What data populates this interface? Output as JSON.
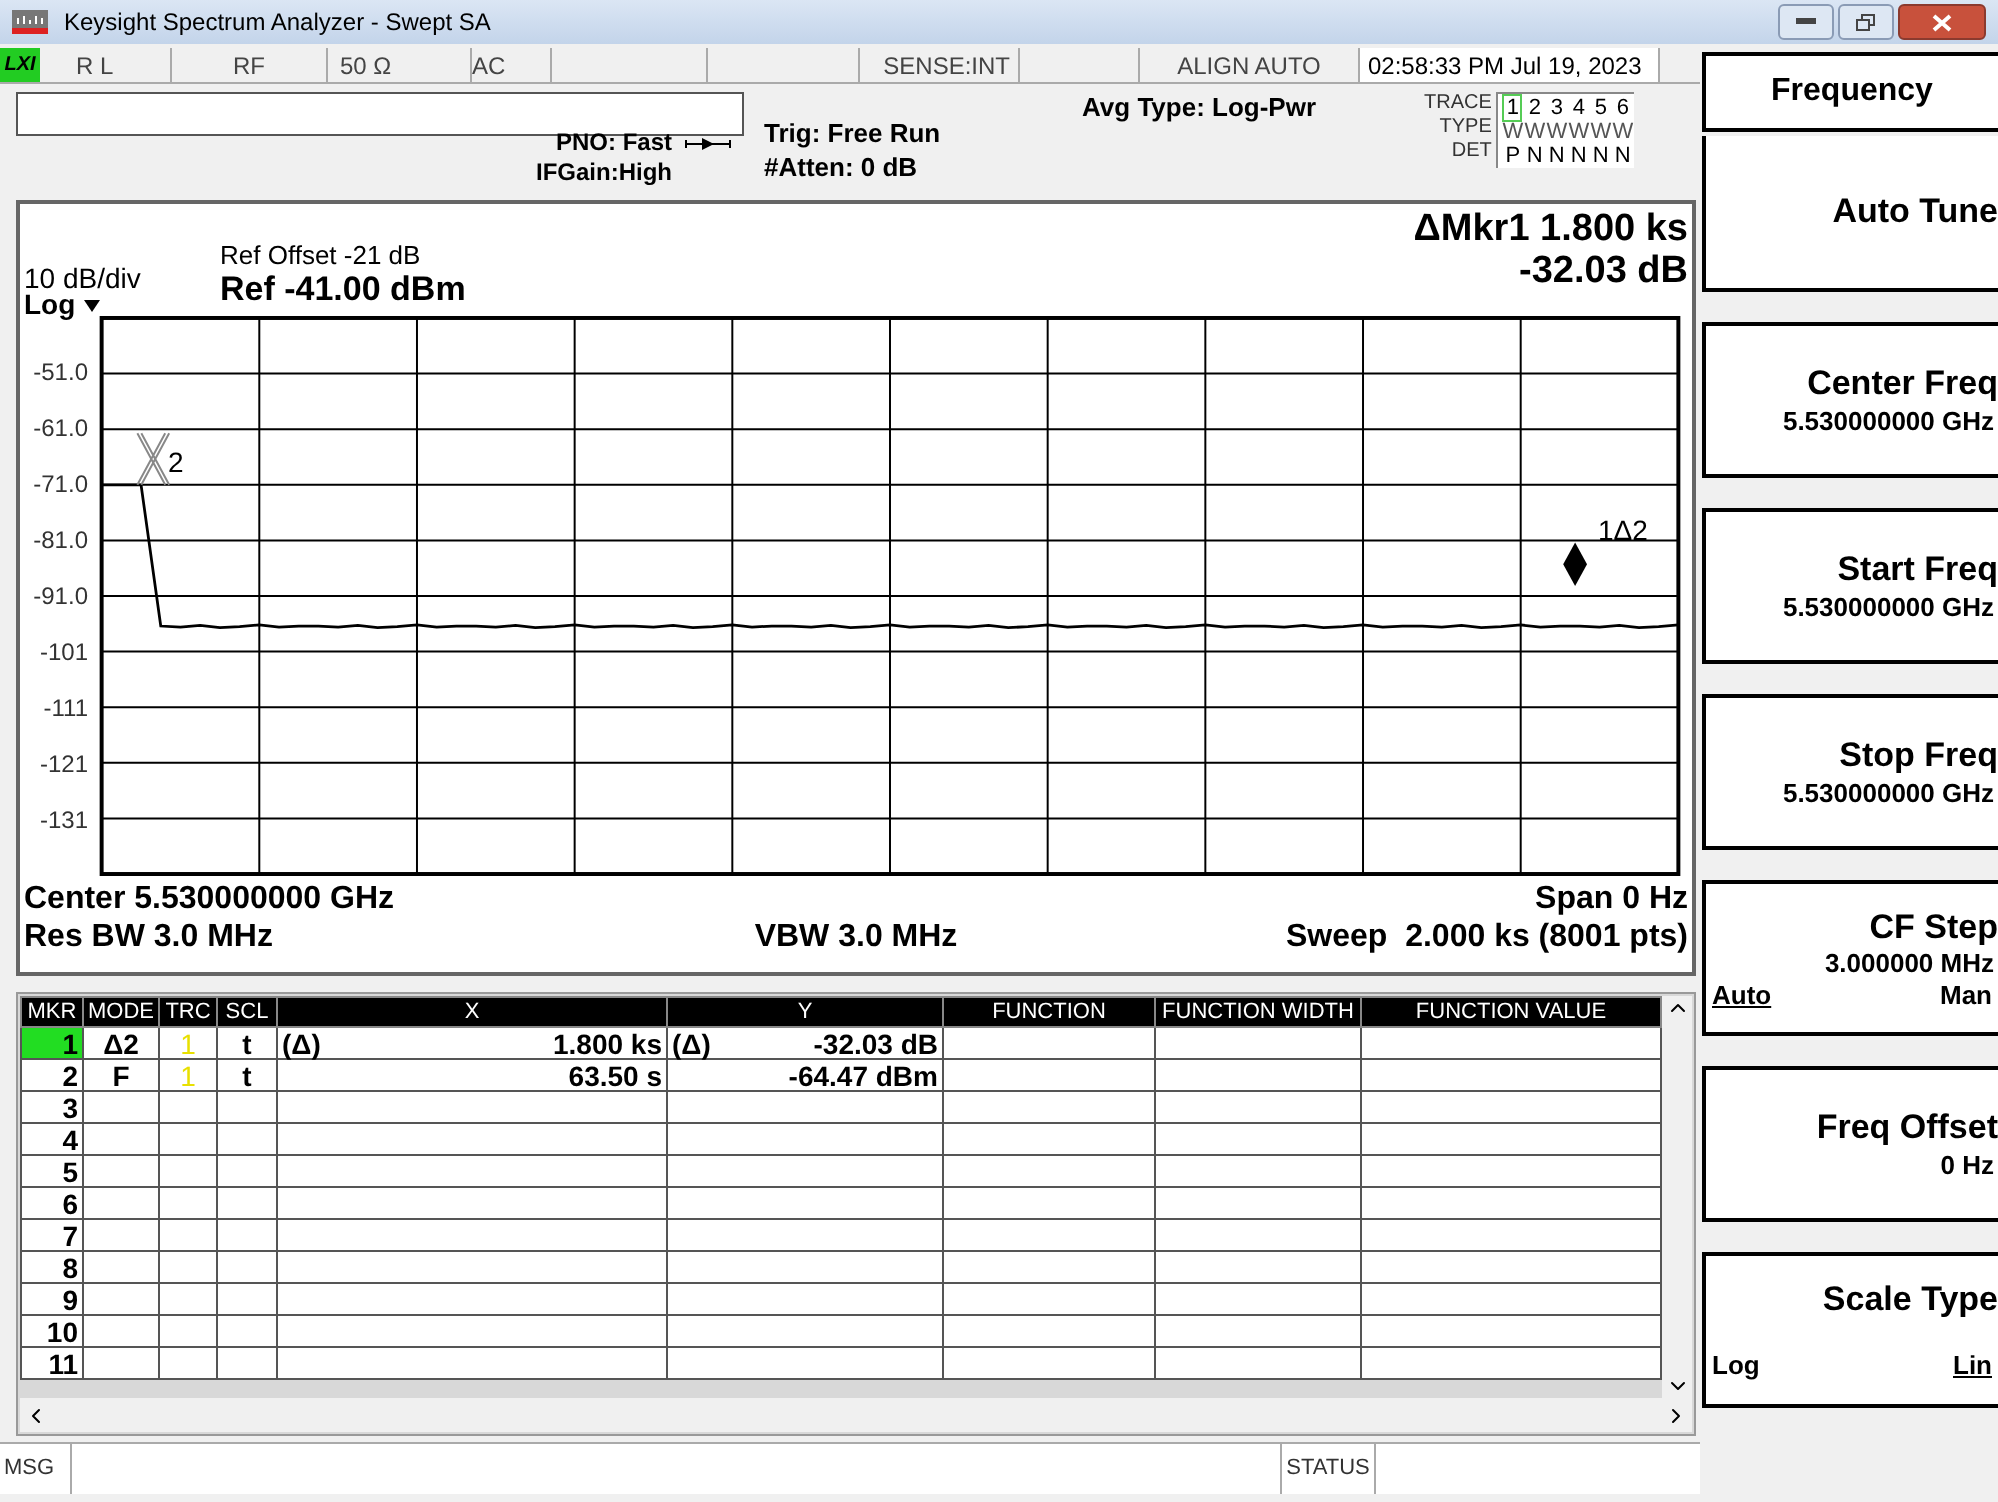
{
  "window": {
    "title": "Keysight Spectrum Analyzer - Swept SA"
  },
  "status_row": {
    "logo": "LXI",
    "cells": [
      "R L",
      "RF",
      "50 Ω",
      "AC",
      "",
      "",
      "SENSE:INT",
      "",
      "ALIGN AUTO",
      "02:58:33 PM Jul 19, 2023"
    ]
  },
  "header": {
    "pno": "PNO: Fast",
    "ifgain": "IFGain:High",
    "trig": "Trig: Free Run",
    "atten": "#Atten: 0 dB",
    "avg_type": "Avg Type: Log-Pwr",
    "trace_labels": [
      "TRACE",
      "TYPE",
      "DET"
    ],
    "traces": [
      {
        "number": "1",
        "type": "W",
        "det": "P",
        "selected": true
      },
      {
        "number": "2",
        "type": "W",
        "det": "N",
        "selected": false
      },
      {
        "number": "3",
        "type": "W",
        "det": "N",
        "selected": false
      },
      {
        "number": "4",
        "type": "W",
        "det": "N",
        "selected": false
      },
      {
        "number": "5",
        "type": "W",
        "det": "N",
        "selected": false
      },
      {
        "number": "6",
        "type": "W",
        "det": "N",
        "selected": false
      }
    ]
  },
  "plot": {
    "scale": "10 dB/div",
    "scale_type": "Log",
    "ref_offset": "Ref Offset -21 dB",
    "ref_level": "Ref -41.00 dBm",
    "marker_readout": "ΔMkr1 1.800 ks",
    "marker_value": "-32.03 dB",
    "chart_data": {
      "type": "line",
      "grid": true,
      "ylim": [
        -141,
        -41
      ],
      "yticks": [
        {
          "value": -51,
          "label": "-51.0"
        },
        {
          "value": -61,
          "label": "-61.0"
        },
        {
          "value": -71,
          "label": "-71.0"
        },
        {
          "value": -81,
          "label": "-81.0"
        },
        {
          "value": -91,
          "label": "-91.0"
        },
        {
          "value": -101,
          "label": "-101"
        },
        {
          "value": -111,
          "label": "-111"
        },
        {
          "value": -121,
          "label": "-121"
        },
        {
          "value": -131,
          "label": "-131"
        }
      ],
      "categories": [
        null,
        null,
        null,
        null,
        null,
        null,
        null,
        null,
        null,
        null,
        null,
        null,
        null,
        null,
        null,
        null,
        null,
        null,
        null,
        null,
        null,
        null,
        null,
        null,
        null,
        null,
        null,
        null,
        null,
        null,
        null,
        null,
        null,
        null,
        null,
        null,
        null,
        null,
        null,
        null,
        null,
        null,
        null,
        null,
        null,
        null,
        null,
        null,
        null,
        null,
        null,
        null,
        null,
        null,
        null,
        null,
        null,
        null,
        null,
        null,
        null,
        null,
        null,
        null,
        null,
        null,
        null,
        null,
        null,
        null,
        null,
        null,
        null,
        null,
        null,
        null,
        null,
        null,
        null,
        null,
        null
      ],
      "series": [
        {
          "color": "#000000",
          "values": [
            -71,
            -71,
            -71,
            -96.4,
            -96.6,
            -96.3,
            -96.7,
            -96.5,
            -96.2,
            -96.6,
            -96.4,
            -96.4,
            -96.6,
            -96.3,
            -96.7,
            -96.5,
            -96.2,
            -96.6,
            -96.4,
            -96.4,
            -96.6,
            -96.3,
            -96.7,
            -96.5,
            -96.2,
            -96.6,
            -96.4,
            -96.4,
            -96.6,
            -96.3,
            -96.7,
            -96.5,
            -96.2,
            -96.6,
            -96.4,
            -96.4,
            -96.6,
            -96.3,
            -96.7,
            -96.5,
            -96.2,
            -96.6,
            -96.4,
            -96.4,
            -96.6,
            -96.3,
            -96.7,
            -96.5,
            -96.2,
            -96.6,
            -96.4,
            -96.4,
            -96.6,
            -96.3,
            -96.7,
            -96.5,
            -96.2,
            -96.6,
            -96.4,
            -96.4,
            -96.6,
            -96.3,
            -96.7,
            -96.5,
            -96.2,
            -96.6,
            -96.4,
            -96.4,
            -96.6,
            -96.3,
            -96.7,
            -96.5,
            -96.2,
            -96.6,
            -96.4,
            -96.4,
            -96.6,
            -96.3,
            -96.7,
            -96.5,
            -96.2
          ]
        }
      ]
    },
    "marker_labels": [
      "2",
      "1Δ2"
    ],
    "center": "Center 5.530000000 GHz",
    "span": "Span 0 Hz",
    "res_bw": "Res BW 3.0 MHz",
    "vbw": "VBW 3.0 MHz",
    "sweep": "Sweep  2.000 ks (8001 pts)"
  },
  "marker_table": {
    "columns": [
      "MKR",
      "MODE",
      "TRC",
      "SCL",
      "X",
      "Y",
      "FUNCTION",
      "FUNCTION WIDTH",
      "FUNCTION VALUE"
    ],
    "rows": [
      {
        "mkr": "1",
        "mode": "Δ2",
        "trc": "1",
        "scl": "t",
        "x_prefix": "(Δ)",
        "x": "1.800 ks",
        "y_prefix": "(Δ)",
        "y": "-32.03 dB",
        "selected": true
      },
      {
        "mkr": "2",
        "mode": "F",
        "trc": "1",
        "scl": "t",
        "x": "63.50 s",
        "y": "-64.47 dBm",
        "selected": false
      },
      {
        "mkr": "3",
        "selected": false
      },
      {
        "mkr": "4",
        "selected": false
      },
      {
        "mkr": "5",
        "selected": false
      },
      {
        "mkr": "6",
        "selected": false
      },
      {
        "mkr": "7",
        "selected": false
      },
      {
        "mkr": "8",
        "selected": false
      },
      {
        "mkr": "9",
        "selected": false
      },
      {
        "mkr": "10",
        "selected": false
      },
      {
        "mkr": "11",
        "selected": false
      }
    ]
  },
  "status_bar": {
    "msg": "MSG",
    "status": "STATUS"
  },
  "softkeys": [
    {
      "kind": "title",
      "label": "Frequency"
    },
    {
      "kind": "plain",
      "label": "Auto Tune"
    },
    {
      "kind": "value",
      "label": "Center Freq",
      "value": "5.530000000 GHz"
    },
    {
      "kind": "value",
      "label": "Start Freq",
      "value": "5.530000000 GHz"
    },
    {
      "kind": "value",
      "label": "Stop Freq",
      "value": "5.530000000 GHz"
    },
    {
      "kind": "toggle",
      "label": "CF Step",
      "value": "3.000000 MHz",
      "options": [
        {
          "label": "Auto",
          "selected": true
        },
        {
          "label": "Man",
          "selected": false
        }
      ]
    },
    {
      "kind": "value",
      "label": "Freq Offset",
      "value": "0 Hz"
    },
    {
      "kind": "toggle",
      "label": "Scale Type",
      "options": [
        {
          "label": "Log",
          "selected": false
        },
        {
          "label": "Lin",
          "selected": true
        }
      ]
    }
  ]
}
